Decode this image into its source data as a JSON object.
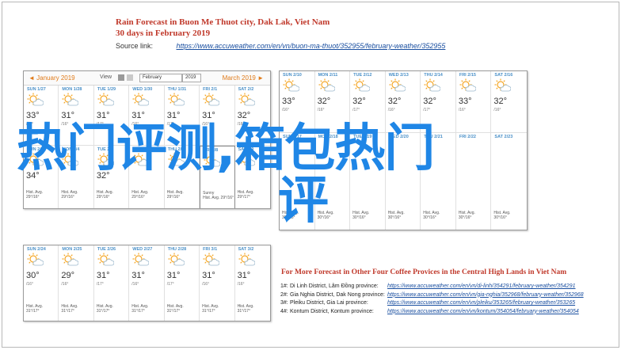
{
  "header": {
    "title": "Rain Forecast in Buon Me Thuot city, Dak Lak, Viet Nam",
    "subtitle": "30 days in February 2019",
    "source_label": "Source link:",
    "source_url": "https://www.accuweather.com/en/vn/buon-ma-thuot/352955/february-weather/352955"
  },
  "nav": {
    "prev": "◄ January 2019",
    "view_label": "View",
    "month_select": "February",
    "year_select": "2019",
    "next": "March 2019 ►"
  },
  "calendar_top": {
    "row1": [
      {
        "day": "SUN 1/27",
        "temp": "33°",
        "hi": "/16°"
      },
      {
        "day": "MON 1/28",
        "temp": "31°",
        "hi": "/16°"
      },
      {
        "day": "TUE 1/29",
        "temp": "31°",
        "hi": "/17°"
      },
      {
        "day": "WED 1/30",
        "temp": "31°",
        "hi": "/16°"
      },
      {
        "day": "THU 1/31",
        "temp": "31°",
        "hi": "/17°"
      },
      {
        "day": "FRI 2/1",
        "temp": "31°",
        "hi": "/16°"
      },
      {
        "day": "SAT 2/2",
        "temp": "32°",
        "hi": "/16°"
      }
    ],
    "row2": [
      {
        "day": "SUN 2/3",
        "temp": "34°",
        "avg1": "Hist. Avg.",
        "avg2": "29°/16°"
      },
      {
        "day": "MON 2/4",
        "temp": "",
        "avg1": "Hist. Avg.",
        "avg2": "29°/16°"
      },
      {
        "day": "TUE 2/5",
        "temp": "32°",
        "avg1": "Hist. Avg.",
        "avg2": "29°/16°"
      },
      {
        "day": "WED 2/6",
        "temp": "",
        "avg1": "Hist. Avg.",
        "avg2": "29°/16°"
      },
      {
        "day": "THU 2/7",
        "temp": "",
        "avg1": "Hist. Avg.",
        "avg2": "29°/16°"
      },
      {
        "day": "FRI 2/8",
        "temp": "",
        "avg1": "Sunny",
        "avg2": "Hist. Avg. 29°/16°"
      },
      {
        "day": "SAT 2/9",
        "temp": "",
        "avg1": "Hist. Avg.",
        "avg2": "29°/17°"
      }
    ]
  },
  "calendar_right": {
    "row1": [
      {
        "day": "SUN 2/10",
        "temp": "33°",
        "hi": "/16°"
      },
      {
        "day": "MON 2/11",
        "temp": "32°",
        "hi": "/16°"
      },
      {
        "day": "TUE 2/12",
        "temp": "32°",
        "hi": "/17°"
      },
      {
        "day": "WED 2/13",
        "temp": "32°",
        "hi": "/16°"
      },
      {
        "day": "THU 2/14",
        "temp": "32°",
        "hi": "/17°"
      },
      {
        "day": "FRI 2/15",
        "temp": "33°",
        "hi": "/16°"
      },
      {
        "day": "SAT 2/16",
        "temp": "32°",
        "hi": "/16°"
      }
    ],
    "row2": [
      {
        "day": "SUN 2/17",
        "temp": "",
        "avg1": "Hist. Avg.",
        "avg2": "30°/16°"
      },
      {
        "day": "MON 2/18",
        "temp": "",
        "avg1": "Hist. Avg.",
        "avg2": "30°/16°"
      },
      {
        "day": "TUE 2/19",
        "temp": "",
        "avg1": "Hist. Avg.",
        "avg2": "30°/16°"
      },
      {
        "day": "WED 2/20",
        "temp": "",
        "avg1": "Hist. Avg.",
        "avg2": "30°/16°"
      },
      {
        "day": "THU 2/21",
        "temp": "",
        "avg1": "Hist. Avg.",
        "avg2": "30°/16°"
      },
      {
        "day": "FRI 2/22",
        "temp": "",
        "avg1": "Hist. Avg.",
        "avg2": "30°/16°"
      },
      {
        "day": "SAT 2/23",
        "temp": "",
        "avg1": "Hist. Avg.",
        "avg2": "30°/16°"
      }
    ]
  },
  "calendar_bottom": [
    {
      "day": "SUN 2/24",
      "temp": "30°",
      "hi": "/16°",
      "avg1": "Hist. Avg.",
      "avg2": "31°/17°"
    },
    {
      "day": "MON 2/25",
      "temp": "29°",
      "hi": "/16°",
      "avg1": "Hist. Avg.",
      "avg2": "31°/17°"
    },
    {
      "day": "TUE 2/26",
      "temp": "31°",
      "hi": "/17°",
      "avg1": "Hist. Avg.",
      "avg2": "31°/17°"
    },
    {
      "day": "WED 2/27",
      "temp": "31°",
      "hi": "/16°",
      "avg1": "Hist. Avg.",
      "avg2": "31°/17°"
    },
    {
      "day": "THU 2/28",
      "temp": "31°",
      "hi": "/17°",
      "avg1": "Hist. Avg.",
      "avg2": "31°/17°"
    },
    {
      "day": "FRI 3/1",
      "temp": "31°",
      "hi": "/16°",
      "avg1": "Hist. Avg.",
      "avg2": "31°/17°"
    },
    {
      "day": "SAT 3/2",
      "temp": "31°",
      "hi": "/16°",
      "avg1": "Hist. Avg.",
      "avg2": "31°/17°"
    }
  ],
  "overlay": {
    "line1": "热门评测,箱包热门",
    "line2": "评"
  },
  "more": {
    "title": "For More Forecast in Other Four Coffee Provices in the Central High Lands in Viet Nam",
    "rows": [
      {
        "n": "1#:",
        "place": "Di Linh District, Lâm Đồng province:",
        "url": "https://www.accuweather.com/en/vn/di-linh/354291/february-weather/354291"
      },
      {
        "n": "2#:",
        "place": "Gia Nghia District, Dak Nong province:",
        "url": "https://www.accuweather.com/en/vn/gia-nghia/352968/february-weather/352968"
      },
      {
        "n": "3#:",
        "place": "Pleiku District, Gia Lai province:",
        "url": "https://www.accuweather.com/en/vn/pleiku/353265/february-weather/353265"
      },
      {
        "n": "4#:",
        "place": "Kontum District, Kontum province:",
        "url": "https://www.accuweather.com/en/vn/kontum/354054/february-weather/354054"
      }
    ]
  },
  "colors": {
    "accent_red": "#c0392b",
    "link_blue": "#1a4fa0",
    "sun": "#f5a623",
    "overlay_blue": "#1f86e6"
  }
}
